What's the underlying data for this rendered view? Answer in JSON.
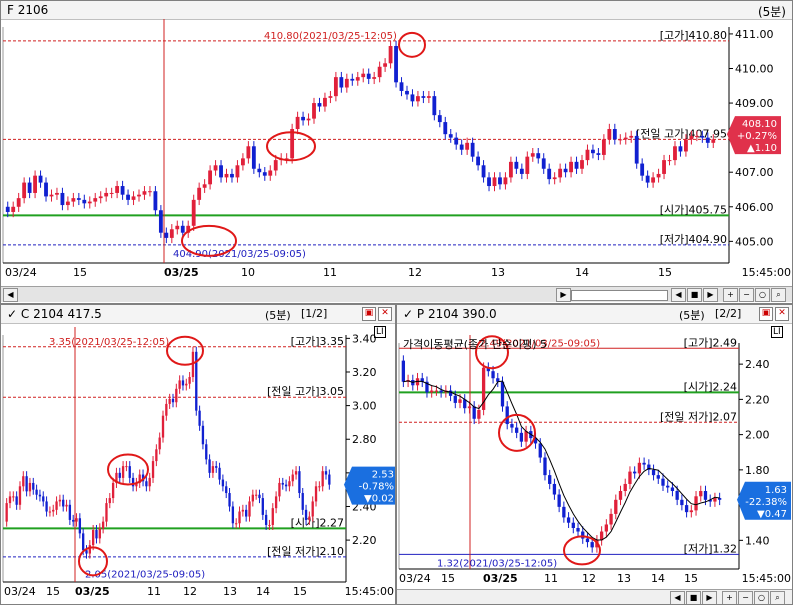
{
  "top": {
    "title": "F 2106",
    "period": "(5분)",
    "high_marker": "410.80(2021/03/25-12:05)",
    "low_marker": "404.90(2021/03/25-09:05)",
    "levels": {
      "high": "[고가]410.80",
      "prev_high": "[전일 고가]407.95",
      "open": "[시가]405.75",
      "low": "[저가]404.90"
    },
    "y_ticks": [
      "411.00",
      "410.00",
      "409.00",
      "408.00",
      "407.00",
      "406.00",
      "405.00"
    ],
    "x_labels": [
      "03/24",
      "15",
      "03/25",
      "10",
      "11",
      "12",
      "13",
      "14",
      "15",
      "15:45:00"
    ],
    "badge": {
      "price": "408.10",
      "pct": "+0.27%",
      "chg": "▲1.10",
      "color": "#e0314b"
    },
    "chart_data": {
      "type": "candlestick",
      "ylim": [
        404.75,
        411.2
      ],
      "series": [
        {
          "name": "F 2106",
          "open": [
            406.0,
            405.85,
            406.0,
            406.25,
            406.7,
            406.4,
            406.9,
            406.7,
            406.3,
            406.35,
            406.4,
            406.05,
            406.15,
            406.25,
            406.2,
            406.1,
            406.15,
            406.25,
            406.3,
            406.4,
            406.4,
            406.6,
            406.35,
            406.2,
            406.3,
            406.35,
            406.45,
            406.45,
            405.9,
            405.25,
            405.1,
            405.35,
            405.45,
            405.25,
            405.45,
            406.2,
            406.55,
            406.65,
            407.05,
            407.2,
            406.85,
            406.95,
            406.85,
            407.2,
            407.4,
            407.75,
            407.1,
            407.0,
            406.9,
            407.05,
            407.35,
            407.4,
            407.4,
            408.25,
            408.6,
            408.5,
            408.55,
            409.0,
            408.9,
            409.15,
            409.2,
            409.75,
            409.45,
            409.7,
            409.65,
            409.75,
            409.85,
            409.7,
            409.75,
            410.05,
            410.15,
            410.65,
            409.6,
            409.35,
            409.25,
            409.05,
            409.2,
            409.15,
            409.2,
            408.65,
            408.45,
            408.1,
            408.0,
            407.8,
            407.65,
            407.85,
            407.45,
            407.2,
            406.85,
            406.6,
            406.85,
            406.65,
            406.85,
            407.3,
            407.1,
            406.95,
            407.45,
            407.55,
            407.4,
            407.1,
            406.8,
            406.85,
            407.1,
            407.0,
            407.3,
            407.1,
            407.35,
            407.65,
            407.55,
            407.5,
            407.95,
            408.25,
            407.95,
            407.95,
            408.0,
            408.05,
            407.25,
            406.9,
            406.7,
            406.85,
            406.95,
            407.35,
            407.35,
            407.75,
            407.6,
            407.95,
            408.05,
            408.05,
            408.0,
            407.85
          ],
          "close": [
            405.85,
            406.0,
            406.25,
            406.7,
            406.4,
            406.9,
            406.7,
            406.3,
            406.35,
            406.4,
            406.05,
            406.15,
            406.25,
            406.2,
            406.1,
            406.15,
            406.25,
            406.3,
            406.4,
            406.4,
            406.6,
            406.35,
            406.2,
            406.3,
            406.35,
            406.45,
            406.45,
            405.9,
            405.25,
            405.1,
            405.35,
            405.45,
            405.25,
            405.45,
            406.2,
            406.55,
            406.65,
            407.05,
            407.2,
            406.85,
            406.95,
            406.85,
            407.2,
            407.4,
            407.75,
            407.1,
            407.0,
            406.9,
            407.05,
            407.35,
            407.4,
            407.4,
            408.25,
            408.6,
            408.5,
            408.55,
            409.0,
            408.9,
            409.15,
            409.2,
            409.75,
            409.45,
            409.7,
            409.65,
            409.75,
            409.85,
            409.7,
            409.75,
            410.05,
            410.15,
            410.65,
            409.6,
            409.35,
            409.25,
            409.05,
            409.2,
            409.15,
            409.2,
            408.65,
            408.45,
            408.1,
            408.0,
            407.8,
            407.65,
            407.85,
            407.45,
            407.2,
            406.85,
            406.6,
            406.85,
            406.65,
            406.85,
            407.3,
            407.1,
            406.95,
            407.45,
            407.55,
            407.4,
            407.1,
            406.8,
            406.85,
            407.1,
            407.0,
            407.3,
            407.1,
            407.35,
            407.65,
            407.55,
            407.5,
            407.95,
            408.25,
            407.95,
            407.95,
            408.0,
            408.05,
            407.25,
            406.9,
            406.7,
            406.85,
            406.95,
            407.35,
            407.35,
            407.75,
            407.6,
            407.95,
            408.05,
            408.05,
            408.0,
            407.85,
            407.95
          ]
        }
      ]
    }
  },
  "c": {
    "title": "C 2104 417.5",
    "period": "(5분)",
    "page": "[1/2]",
    "high_marker": "3.35(2021/03/25-12:05)",
    "low_marker": "2.05(2021/03/25-09:05)",
    "levels": {
      "high": "[고가]3.35",
      "prev_high": "[전일 고가]3.05",
      "open": "[시가]2.27",
      "prev_low": "[전일 저가]2.10"
    },
    "y_ticks": [
      "3.40",
      "3.20",
      "3.00",
      "2.80",
      "2.60",
      "2.40",
      "2.20"
    ],
    "x_labels": [
      "03/24",
      "15",
      "03/25",
      "11",
      "12",
      "13",
      "14",
      "15",
      "15:45:00"
    ],
    "badge": {
      "price": "2.53",
      "pct": "-0.78%",
      "chg": "▼0.02",
      "color": "#1a6fe0"
    },
    "chart_data": {
      "type": "candlestick",
      "ylim": [
        2.04,
        3.42
      ],
      "series": [
        {
          "name": "C 2104 417.5",
          "open": [
            2.31,
            2.42,
            2.46,
            2.46,
            2.41,
            2.52,
            2.58,
            2.49,
            2.54,
            2.5,
            2.47,
            2.46,
            2.43,
            2.37,
            2.37,
            2.38,
            2.43,
            2.44,
            2.4,
            2.41,
            2.32,
            2.31,
            2.33,
            2.24,
            2.14,
            2.12,
            2.17,
            2.26,
            2.21,
            2.27,
            2.31,
            2.42,
            2.45,
            2.54,
            2.6,
            2.57,
            2.64,
            2.64,
            2.57,
            2.52,
            2.54,
            2.59,
            2.55,
            2.52,
            2.57,
            2.67,
            2.74,
            2.81,
            2.94,
            3.01,
            3.04,
            3.02,
            3.1,
            3.15,
            3.12,
            3.13,
            3.17,
            3.32,
            2.97,
            2.88,
            2.77,
            2.68,
            2.6,
            2.64,
            2.63,
            2.56,
            2.52,
            2.48,
            2.4,
            2.3,
            2.3,
            2.37,
            2.38,
            2.34,
            2.43,
            2.47,
            2.47,
            2.45,
            2.35,
            2.29,
            2.29,
            2.39,
            2.46,
            2.54,
            2.53,
            2.52,
            2.55,
            2.59,
            2.61,
            2.48,
            2.38,
            2.32,
            2.34,
            2.43,
            2.52,
            2.52,
            2.61,
            2.59
          ],
          "close": [
            2.42,
            2.46,
            2.46,
            2.41,
            2.52,
            2.58,
            2.49,
            2.54,
            2.5,
            2.47,
            2.46,
            2.43,
            2.37,
            2.37,
            2.38,
            2.43,
            2.44,
            2.4,
            2.41,
            2.32,
            2.31,
            2.33,
            2.24,
            2.14,
            2.12,
            2.17,
            2.26,
            2.21,
            2.27,
            2.31,
            2.42,
            2.45,
            2.54,
            2.6,
            2.57,
            2.64,
            2.64,
            2.57,
            2.52,
            2.54,
            2.59,
            2.55,
            2.52,
            2.57,
            2.67,
            2.74,
            2.81,
            2.94,
            3.01,
            3.04,
            3.02,
            3.1,
            3.15,
            3.12,
            3.13,
            3.17,
            3.32,
            2.97,
            2.88,
            2.77,
            2.68,
            2.6,
            2.64,
            2.63,
            2.56,
            2.52,
            2.48,
            2.4,
            2.3,
            2.3,
            2.37,
            2.38,
            2.34,
            2.43,
            2.47,
            2.47,
            2.45,
            2.35,
            2.29,
            2.29,
            2.39,
            2.46,
            2.54,
            2.53,
            2.52,
            2.55,
            2.59,
            2.61,
            2.48,
            2.38,
            2.32,
            2.34,
            2.43,
            2.52,
            2.52,
            2.61,
            2.59,
            2.53
          ]
        }
      ]
    }
  },
  "p": {
    "title": "P 2104 390.0",
    "period": "(5분)",
    "page": "[2/2]",
    "ma_label": "가격이동평균(종가 단순이평) 5",
    "high_marker": "2.49(2021/03/25-09:05)",
    "low_marker": "1.32(2021/03/25-12:05)",
    "levels": {
      "high": "[고가]2.49",
      "open": "[시가]2.24",
      "prev_low": "[전일 저가]2.07",
      "low": "[저가]1.32"
    },
    "y_ticks": [
      "2.40",
      "2.20",
      "2.00",
      "1.80",
      "1.60",
      "1.40"
    ],
    "x_labels": [
      "03/24",
      "15",
      "03/25",
      "11",
      "12",
      "13",
      "14",
      "15",
      "15:45:00"
    ],
    "badge": {
      "price": "1.63",
      "pct": "-22.38%",
      "chg": "▼0.47",
      "color": "#1a6fe0"
    },
    "chart_data": {
      "type": "candlestick",
      "ylim": [
        1.26,
        2.52
      ],
      "series": [
        {
          "name": "P 2104 390.0",
          "open": [
            2.42,
            2.3,
            2.31,
            2.28,
            2.32,
            2.3,
            2.24,
            2.25,
            2.25,
            2.24,
            2.25,
            2.22,
            2.18,
            2.2,
            2.15,
            2.16,
            2.09,
            2.14,
            2.38,
            2.36,
            2.32,
            2.3,
            2.16,
            2.06,
            2.04,
            2.01,
            1.96,
            2.02,
            1.98,
            1.95,
            1.87,
            1.77,
            1.72,
            1.66,
            1.59,
            1.53,
            1.5,
            1.47,
            1.45,
            1.41,
            1.39,
            1.36,
            1.4,
            1.45,
            1.49,
            1.55,
            1.63,
            1.68,
            1.72,
            1.79,
            1.78,
            1.84,
            1.83,
            1.8,
            1.77,
            1.75,
            1.71,
            1.7,
            1.68,
            1.63,
            1.6,
            1.56,
            1.57,
            1.65,
            1.68,
            1.63,
            1.62,
            1.64
          ],
          "close": [
            2.3,
            2.31,
            2.28,
            2.32,
            2.3,
            2.24,
            2.25,
            2.25,
            2.24,
            2.25,
            2.22,
            2.18,
            2.2,
            2.15,
            2.16,
            2.09,
            2.14,
            2.38,
            2.36,
            2.32,
            2.3,
            2.16,
            2.06,
            2.04,
            2.01,
            1.96,
            2.02,
            1.98,
            1.95,
            1.87,
            1.77,
            1.72,
            1.66,
            1.59,
            1.53,
            1.5,
            1.47,
            1.45,
            1.41,
            1.39,
            1.36,
            1.4,
            1.45,
            1.49,
            1.55,
            1.63,
            1.68,
            1.72,
            1.79,
            1.78,
            1.84,
            1.83,
            1.8,
            1.77,
            1.75,
            1.71,
            1.7,
            1.68,
            1.63,
            1.6,
            1.56,
            1.57,
            1.65,
            1.68,
            1.63,
            1.62,
            1.64,
            1.63
          ]
        },
        {
          "name": "가격이동평균(종가 단순이평) 5",
          "type": "line"
        }
      ]
    }
  }
}
